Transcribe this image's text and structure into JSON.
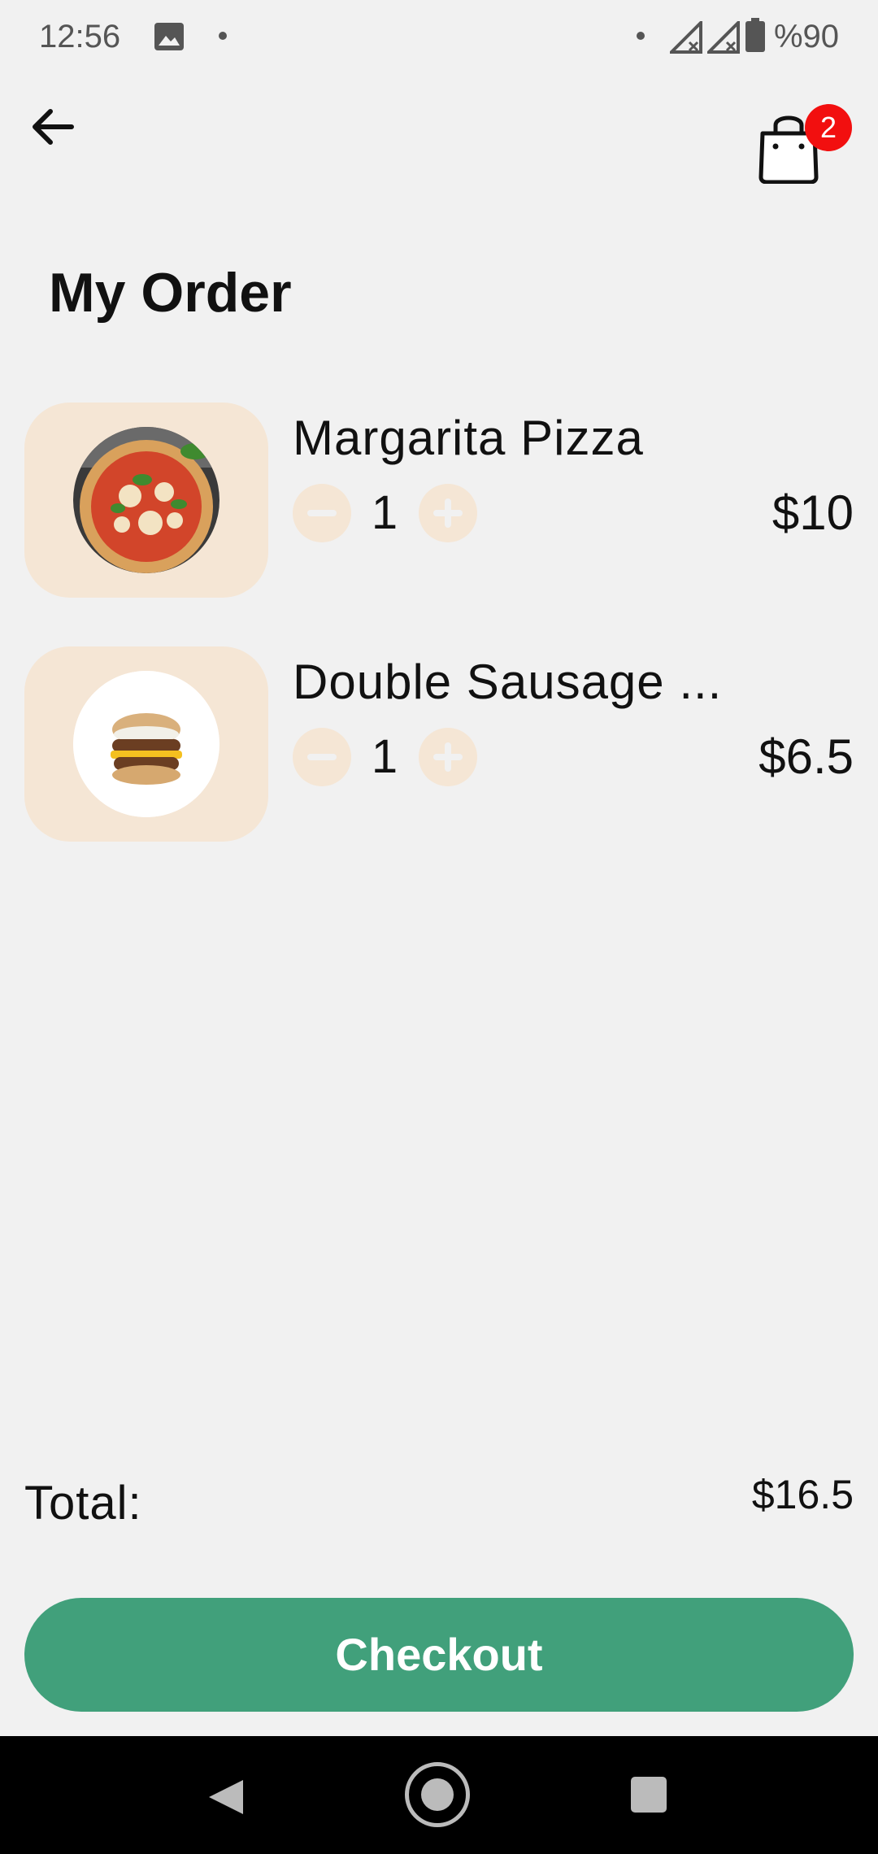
{
  "status_bar": {
    "time": "12:56",
    "battery_text": "%90"
  },
  "header": {
    "cart_count": "2"
  },
  "page": {
    "title": "My Order"
  },
  "items": [
    {
      "name": "Margarita Pizza",
      "quantity": "1",
      "price": "$10"
    },
    {
      "name": "Double Sausage ...",
      "quantity": "1",
      "price": "$6.5"
    }
  ],
  "summary": {
    "total_label": "Total:",
    "total_value": "$16.5"
  },
  "actions": {
    "checkout_label": "Checkout"
  },
  "colors": {
    "background": "#f1f1f1",
    "accent": "#41a07b",
    "thumb_bg": "#f5e6d5",
    "badge": "#f20f0f"
  }
}
